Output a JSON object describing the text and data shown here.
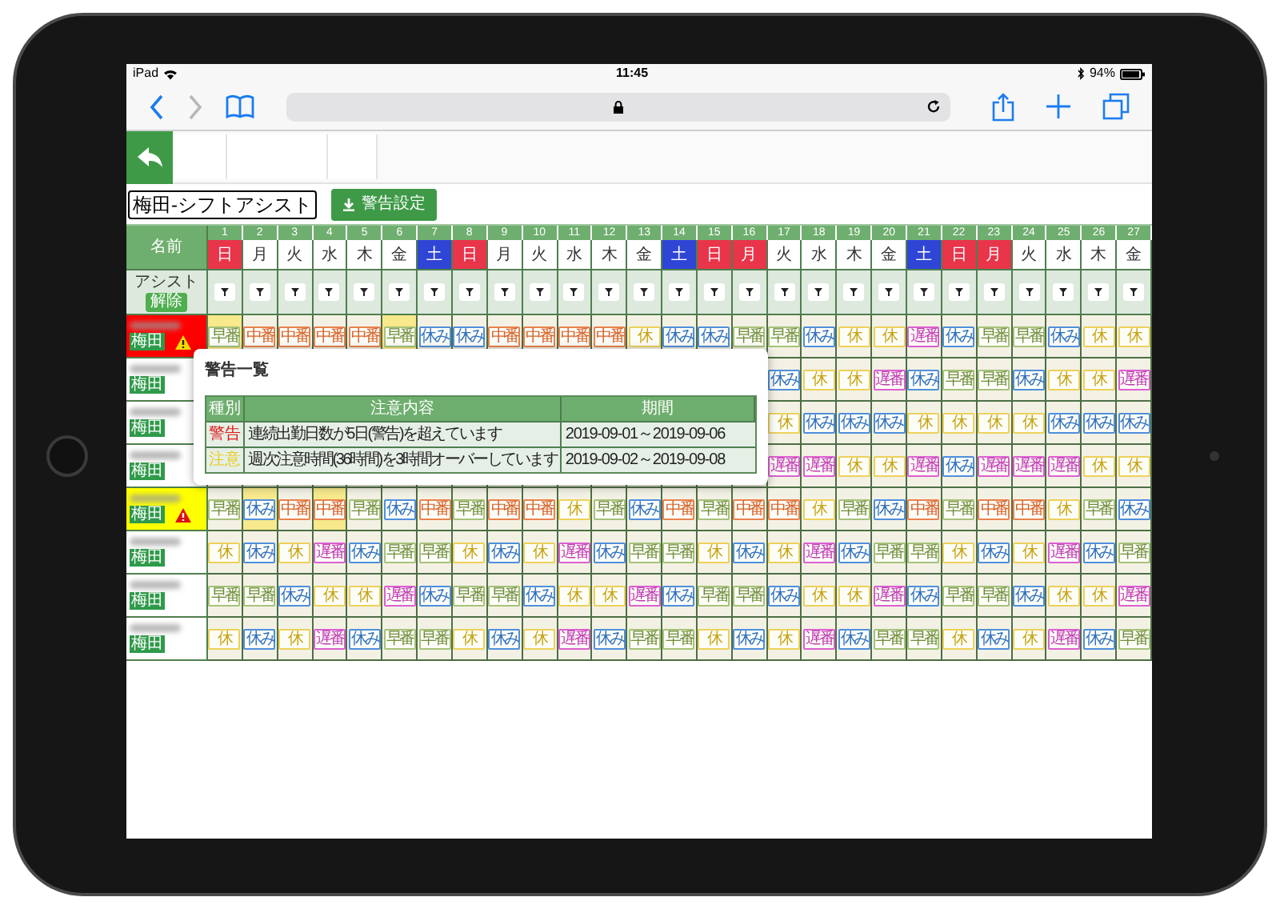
{
  "status_bar": {
    "device": "iPad",
    "time": "11:45",
    "battery": "94%"
  },
  "header": {
    "title": "梅田-シフトアシスト",
    "alert_settings_button": "警告設定"
  },
  "table": {
    "name_header": "名前",
    "assist_label": "アシスト",
    "clear_button": "解除",
    "days": [
      {
        "day": "1",
        "weekday": "日",
        "kind": "holiday"
      },
      {
        "day": "2",
        "weekday": "月",
        "kind": "weekday"
      },
      {
        "day": "3",
        "weekday": "火",
        "kind": "weekday"
      },
      {
        "day": "4",
        "weekday": "水",
        "kind": "weekday"
      },
      {
        "day": "5",
        "weekday": "木",
        "kind": "weekday"
      },
      {
        "day": "6",
        "weekday": "金",
        "kind": "weekday"
      },
      {
        "day": "7",
        "weekday": "土",
        "kind": "saturday"
      },
      {
        "day": "8",
        "weekday": "日",
        "kind": "holiday"
      },
      {
        "day": "9",
        "weekday": "月",
        "kind": "weekday"
      },
      {
        "day": "10",
        "weekday": "火",
        "kind": "weekday"
      },
      {
        "day": "11",
        "weekday": "水",
        "kind": "weekday"
      },
      {
        "day": "12",
        "weekday": "木",
        "kind": "weekday"
      },
      {
        "day": "13",
        "weekday": "金",
        "kind": "weekday"
      },
      {
        "day": "14",
        "weekday": "土",
        "kind": "saturday"
      },
      {
        "day": "15",
        "weekday": "日",
        "kind": "holiday"
      },
      {
        "day": "16",
        "weekday": "月",
        "kind": "holiday"
      },
      {
        "day": "17",
        "weekday": "火",
        "kind": "weekday"
      },
      {
        "day": "18",
        "weekday": "水",
        "kind": "weekday"
      },
      {
        "day": "19",
        "weekday": "木",
        "kind": "weekday"
      },
      {
        "day": "20",
        "weekday": "金",
        "kind": "weekday"
      },
      {
        "day": "21",
        "weekday": "土",
        "kind": "saturday"
      },
      {
        "day": "22",
        "weekday": "日",
        "kind": "holiday"
      },
      {
        "day": "23",
        "weekday": "月",
        "kind": "holiday"
      },
      {
        "day": "24",
        "weekday": "火",
        "kind": "weekday"
      },
      {
        "day": "25",
        "weekday": "水",
        "kind": "weekday"
      },
      {
        "day": "26",
        "weekday": "木",
        "kind": "weekday"
      },
      {
        "day": "27",
        "weekday": "金",
        "kind": "weekday"
      }
    ],
    "rows": [
      {
        "store": "梅田",
        "kind": "error",
        "cells": [
          {
            "shift": "早番",
            "kind": "early",
            "highlighted": true
          },
          {
            "shift": "中番",
            "kind": "mid",
            "highlighted": false
          },
          {
            "shift": "中番",
            "kind": "mid",
            "highlighted": false
          },
          {
            "shift": "中番",
            "kind": "mid",
            "highlighted": false
          },
          {
            "shift": "中番",
            "kind": "mid",
            "highlighted": false
          },
          {
            "shift": "早番",
            "kind": "early",
            "highlighted": true
          },
          {
            "shift": "休み",
            "kind": "off",
            "highlighted": false
          },
          {
            "shift": "休み",
            "kind": "off",
            "highlighted": false
          },
          {
            "shift": "中番",
            "kind": "mid",
            "highlighted": false
          },
          {
            "shift": "中番",
            "kind": "mid",
            "highlighted": false
          },
          {
            "shift": "中番",
            "kind": "mid",
            "highlighted": false
          },
          {
            "shift": "中番",
            "kind": "mid",
            "highlighted": false
          },
          {
            "shift": "休",
            "kind": "rest",
            "highlighted": false
          },
          {
            "shift": "休み",
            "kind": "off",
            "highlighted": false
          },
          {
            "shift": "休み",
            "kind": "off",
            "highlighted": false
          },
          {
            "shift": "早番",
            "kind": "early",
            "highlighted": false
          },
          {
            "shift": "早番",
            "kind": "early",
            "highlighted": false
          },
          {
            "shift": "休み",
            "kind": "off",
            "highlighted": false
          },
          {
            "shift": "休",
            "kind": "rest",
            "highlighted": false
          },
          {
            "shift": "休",
            "kind": "rest",
            "highlighted": false
          },
          {
            "shift": "遅番",
            "kind": "late",
            "highlighted": false
          },
          {
            "shift": "休み",
            "kind": "off",
            "highlighted": false
          },
          {
            "shift": "早番",
            "kind": "early",
            "highlighted": false
          },
          {
            "shift": "早番",
            "kind": "early",
            "highlighted": false
          },
          {
            "shift": "休み",
            "kind": "off",
            "highlighted": false
          },
          {
            "shift": "休",
            "kind": "rest",
            "highlighted": false
          },
          {
            "shift": "休",
            "kind": "rest",
            "highlighted": false
          }
        ]
      },
      {
        "store": "梅田",
        "kind": "none",
        "cells": [
          null,
          null,
          null,
          null,
          null,
          null,
          null,
          null,
          null,
          null,
          null,
          null,
          null,
          null,
          null,
          null,
          {
            "shift": "休み",
            "kind": "off",
            "highlighted": false
          },
          {
            "shift": "休",
            "kind": "rest",
            "highlighted": false
          },
          {
            "shift": "休",
            "kind": "rest",
            "highlighted": false
          },
          {
            "shift": "遅番",
            "kind": "late",
            "highlighted": false
          },
          {
            "shift": "休み",
            "kind": "off",
            "highlighted": false
          },
          {
            "shift": "早番",
            "kind": "early",
            "highlighted": false
          },
          {
            "shift": "早番",
            "kind": "early",
            "highlighted": false
          },
          {
            "shift": "休み",
            "kind": "off",
            "highlighted": false
          },
          {
            "shift": "休",
            "kind": "rest",
            "highlighted": false
          },
          {
            "shift": "休",
            "kind": "rest",
            "highlighted": false
          },
          {
            "shift": "遅番",
            "kind": "late",
            "highlighted": false
          }
        ]
      },
      {
        "store": "梅田",
        "kind": "none",
        "cells": [
          null,
          null,
          null,
          null,
          null,
          null,
          null,
          null,
          null,
          null,
          null,
          null,
          null,
          null,
          null,
          null,
          {
            "shift": "休",
            "kind": "rest",
            "highlighted": false
          },
          {
            "shift": "休み",
            "kind": "off",
            "highlighted": false
          },
          {
            "shift": "休み",
            "kind": "off",
            "highlighted": false
          },
          {
            "shift": "休み",
            "kind": "off",
            "highlighted": false
          },
          {
            "shift": "休",
            "kind": "rest",
            "highlighted": false
          },
          {
            "shift": "休",
            "kind": "rest",
            "highlighted": false
          },
          {
            "shift": "休",
            "kind": "rest",
            "highlighted": false
          },
          {
            "shift": "休",
            "kind": "rest",
            "highlighted": false
          },
          {
            "shift": "休み",
            "kind": "off",
            "highlighted": false
          },
          {
            "shift": "休み",
            "kind": "off",
            "highlighted": false
          },
          {
            "shift": "休み",
            "kind": "off",
            "highlighted": false
          }
        ]
      },
      {
        "store": "梅田",
        "kind": "none",
        "cells": [
          null,
          null,
          null,
          null,
          null,
          null,
          null,
          null,
          null,
          null,
          null,
          null,
          null,
          null,
          null,
          null,
          {
            "shift": "遅番",
            "kind": "late",
            "highlighted": false
          },
          {
            "shift": "遅番",
            "kind": "late",
            "highlighted": false
          },
          {
            "shift": "休",
            "kind": "rest",
            "highlighted": false
          },
          {
            "shift": "休",
            "kind": "rest",
            "highlighted": false
          },
          {
            "shift": "遅番",
            "kind": "late",
            "highlighted": false
          },
          {
            "shift": "休み",
            "kind": "off",
            "highlighted": false
          },
          {
            "shift": "遅番",
            "kind": "late",
            "highlighted": false
          },
          {
            "shift": "遅番",
            "kind": "late",
            "highlighted": false
          },
          {
            "shift": "遅番",
            "kind": "late",
            "highlighted": false
          },
          {
            "shift": "休",
            "kind": "rest",
            "highlighted": false
          },
          {
            "shift": "休",
            "kind": "rest",
            "highlighted": false
          }
        ]
      },
      {
        "store": "梅田",
        "kind": "warning",
        "cells": [
          {
            "shift": "早番",
            "kind": "early",
            "highlighted": false
          },
          {
            "shift": "休み",
            "kind": "off",
            "highlighted": true
          },
          {
            "shift": "中番",
            "kind": "mid",
            "highlighted": false
          },
          {
            "shift": "中番",
            "kind": "mid",
            "highlighted": true
          },
          {
            "shift": "早番",
            "kind": "early",
            "highlighted": false
          },
          {
            "shift": "休み",
            "kind": "off",
            "highlighted": false
          },
          {
            "shift": "中番",
            "kind": "mid",
            "highlighted": false
          },
          {
            "shift": "早番",
            "kind": "early",
            "highlighted": false
          },
          {
            "shift": "中番",
            "kind": "mid",
            "highlighted": false
          },
          {
            "shift": "中番",
            "kind": "mid",
            "highlighted": false
          },
          {
            "shift": "休",
            "kind": "rest",
            "highlighted": false
          },
          {
            "shift": "早番",
            "kind": "early",
            "highlighted": false
          },
          {
            "shift": "休み",
            "kind": "off",
            "highlighted": false
          },
          {
            "shift": "中番",
            "kind": "mid",
            "highlighted": false
          },
          {
            "shift": "早番",
            "kind": "early",
            "highlighted": false
          },
          {
            "shift": "中番",
            "kind": "mid",
            "highlighted": false
          },
          {
            "shift": "中番",
            "kind": "mid",
            "highlighted": false
          },
          {
            "shift": "休",
            "kind": "rest",
            "highlighted": false
          },
          {
            "shift": "早番",
            "kind": "early",
            "highlighted": false
          },
          {
            "shift": "休み",
            "kind": "off",
            "highlighted": false
          },
          {
            "shift": "中番",
            "kind": "mid",
            "highlighted": false
          },
          {
            "shift": "早番",
            "kind": "early",
            "highlighted": false
          },
          {
            "shift": "中番",
            "kind": "mid",
            "highlighted": false
          },
          {
            "shift": "中番",
            "kind": "mid",
            "highlighted": false
          },
          {
            "shift": "休",
            "kind": "rest",
            "highlighted": false
          },
          {
            "shift": "早番",
            "kind": "early",
            "highlighted": false
          },
          {
            "shift": "休み",
            "kind": "off",
            "highlighted": false
          }
        ]
      },
      {
        "store": "梅田",
        "kind": "none",
        "cells": [
          {
            "shift": "休",
            "kind": "rest",
            "highlighted": false
          },
          {
            "shift": "休み",
            "kind": "off",
            "highlighted": false
          },
          {
            "shift": "休",
            "kind": "rest",
            "highlighted": false
          },
          {
            "shift": "遅番",
            "kind": "late",
            "highlighted": false
          },
          {
            "shift": "休み",
            "kind": "off",
            "highlighted": false
          },
          {
            "shift": "早番",
            "kind": "early",
            "highlighted": false
          },
          {
            "shift": "早番",
            "kind": "early",
            "highlighted": false
          },
          {
            "shift": "休",
            "kind": "rest",
            "highlighted": false
          },
          {
            "shift": "休み",
            "kind": "off",
            "highlighted": false
          },
          {
            "shift": "休",
            "kind": "rest",
            "highlighted": false
          },
          {
            "shift": "遅番",
            "kind": "late",
            "highlighted": false
          },
          {
            "shift": "休み",
            "kind": "off",
            "highlighted": false
          },
          {
            "shift": "早番",
            "kind": "early",
            "highlighted": false
          },
          {
            "shift": "早番",
            "kind": "early",
            "highlighted": false
          },
          {
            "shift": "休",
            "kind": "rest",
            "highlighted": false
          },
          {
            "shift": "休み",
            "kind": "off",
            "highlighted": false
          },
          {
            "shift": "休",
            "kind": "rest",
            "highlighted": false
          },
          {
            "shift": "遅番",
            "kind": "late",
            "highlighted": false
          },
          {
            "shift": "休み",
            "kind": "off",
            "highlighted": false
          },
          {
            "shift": "早番",
            "kind": "early",
            "highlighted": false
          },
          {
            "shift": "早番",
            "kind": "early",
            "highlighted": false
          },
          {
            "shift": "休",
            "kind": "rest",
            "highlighted": false
          },
          {
            "shift": "休み",
            "kind": "off",
            "highlighted": false
          },
          {
            "shift": "休",
            "kind": "rest",
            "highlighted": false
          },
          {
            "shift": "遅番",
            "kind": "late",
            "highlighted": false
          },
          {
            "shift": "休み",
            "kind": "off",
            "highlighted": false
          },
          {
            "shift": "早番",
            "kind": "early",
            "highlighted": false
          }
        ]
      },
      {
        "store": "梅田",
        "kind": "none",
        "cells": [
          {
            "shift": "早番",
            "kind": "early",
            "highlighted": false
          },
          {
            "shift": "早番",
            "kind": "early",
            "highlighted": false
          },
          {
            "shift": "休み",
            "kind": "off",
            "highlighted": false
          },
          {
            "shift": "休",
            "kind": "rest",
            "highlighted": false
          },
          {
            "shift": "休",
            "kind": "rest",
            "highlighted": false
          },
          {
            "shift": "遅番",
            "kind": "late",
            "highlighted": false
          },
          {
            "shift": "休み",
            "kind": "off",
            "highlighted": false
          },
          {
            "shift": "早番",
            "kind": "early",
            "highlighted": false
          },
          {
            "shift": "早番",
            "kind": "early",
            "highlighted": false
          },
          {
            "shift": "休み",
            "kind": "off",
            "highlighted": false
          },
          {
            "shift": "休",
            "kind": "rest",
            "highlighted": false
          },
          {
            "shift": "休",
            "kind": "rest",
            "highlighted": false
          },
          {
            "shift": "遅番",
            "kind": "late",
            "highlighted": false
          },
          {
            "shift": "休み",
            "kind": "off",
            "highlighted": false
          },
          {
            "shift": "早番",
            "kind": "early",
            "highlighted": false
          },
          {
            "shift": "早番",
            "kind": "early",
            "highlighted": false
          },
          {
            "shift": "休み",
            "kind": "off",
            "highlighted": false
          },
          {
            "shift": "休",
            "kind": "rest",
            "highlighted": false
          },
          {
            "shift": "休",
            "kind": "rest",
            "highlighted": false
          },
          {
            "shift": "遅番",
            "kind": "late",
            "highlighted": false
          },
          {
            "shift": "休み",
            "kind": "off",
            "highlighted": false
          },
          {
            "shift": "早番",
            "kind": "early",
            "highlighted": false
          },
          {
            "shift": "早番",
            "kind": "early",
            "highlighted": false
          },
          {
            "shift": "休み",
            "kind": "off",
            "highlighted": false
          },
          {
            "shift": "休",
            "kind": "rest",
            "highlighted": false
          },
          {
            "shift": "休",
            "kind": "rest",
            "highlighted": false
          },
          {
            "shift": "遅番",
            "kind": "late",
            "highlighted": false
          }
        ]
      },
      {
        "store": "梅田",
        "kind": "none",
        "cells": [
          {
            "shift": "休",
            "kind": "rest",
            "highlighted": false
          },
          {
            "shift": "休み",
            "kind": "off",
            "highlighted": false
          },
          {
            "shift": "休",
            "kind": "rest",
            "highlighted": false
          },
          {
            "shift": "遅番",
            "kind": "late",
            "highlighted": false
          },
          {
            "shift": "休み",
            "kind": "off",
            "highlighted": false
          },
          {
            "shift": "早番",
            "kind": "early",
            "highlighted": false
          },
          {
            "shift": "早番",
            "kind": "early",
            "highlighted": false
          },
          {
            "shift": "休",
            "kind": "rest",
            "highlighted": false
          },
          {
            "shift": "休み",
            "kind": "off",
            "highlighted": false
          },
          {
            "shift": "休",
            "kind": "rest",
            "highlighted": false
          },
          {
            "shift": "遅番",
            "kind": "late",
            "highlighted": false
          },
          {
            "shift": "休み",
            "kind": "off",
            "highlighted": false
          },
          {
            "shift": "早番",
            "kind": "early",
            "highlighted": false
          },
          {
            "shift": "早番",
            "kind": "early",
            "highlighted": false
          },
          {
            "shift": "休",
            "kind": "rest",
            "highlighted": false
          },
          {
            "shift": "休み",
            "kind": "off",
            "highlighted": false
          },
          {
            "shift": "休",
            "kind": "rest",
            "highlighted": false
          },
          {
            "shift": "遅番",
            "kind": "late",
            "highlighted": false
          },
          {
            "shift": "休み",
            "kind": "off",
            "highlighted": false
          },
          {
            "shift": "早番",
            "kind": "early",
            "highlighted": false
          },
          {
            "shift": "早番",
            "kind": "early",
            "highlighted": false
          },
          {
            "shift": "休",
            "kind": "rest",
            "highlighted": false
          },
          {
            "shift": "休み",
            "kind": "off",
            "highlighted": false
          },
          {
            "shift": "休",
            "kind": "rest",
            "highlighted": false
          },
          {
            "shift": "遅番",
            "kind": "late",
            "highlighted": false
          },
          {
            "shift": "休み",
            "kind": "off",
            "highlighted": false
          },
          {
            "shift": "早番",
            "kind": "early",
            "highlighted": false
          }
        ]
      }
    ]
  },
  "warning_popup": {
    "title": "警告一覧",
    "columns": [
      "種別",
      "注意内容",
      "期間"
    ],
    "rows": [
      {
        "type": "警告",
        "kind": "alert",
        "message": "連続出勤日数が5日(警告)を超えています",
        "period": "2019-09-01～2019-09-06"
      },
      {
        "type": "注意",
        "kind": "caution",
        "message": "週次注意時間(36時間)を3時間オーバーしています",
        "period": "2019-09-02～2019-09-08"
      }
    ]
  }
}
